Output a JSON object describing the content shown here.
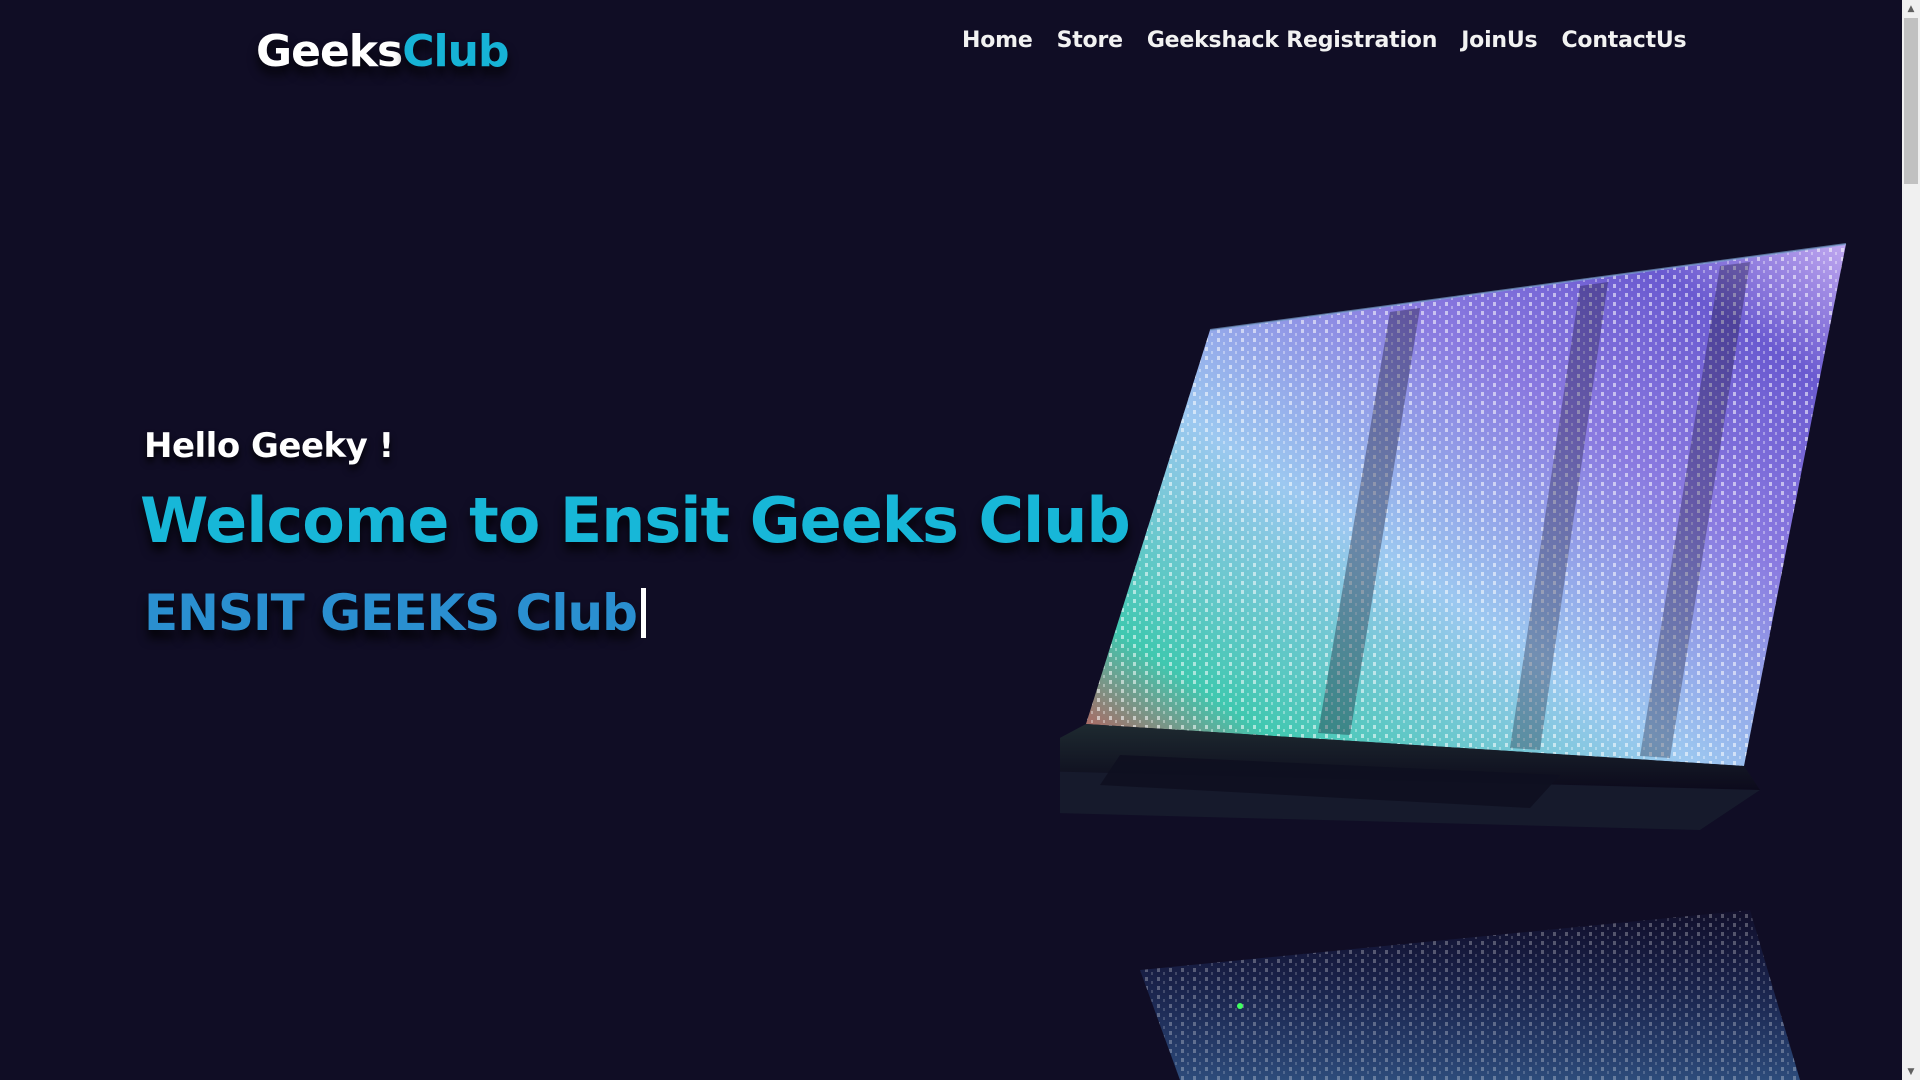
{
  "brand": {
    "part1": "Geeks",
    "part2": "Club",
    "color_primary": "#ffffff",
    "color_accent": "#16b3d6"
  },
  "nav": {
    "items": [
      {
        "label": "Home"
      },
      {
        "label": "Store"
      },
      {
        "label": "Geekshack Registration"
      },
      {
        "label": "JoinUs"
      },
      {
        "label": "ContactUs"
      }
    ]
  },
  "hero": {
    "greeting": "Hello Geeky !",
    "title": "Welcome to Ensit Geeks Club",
    "typed_text": "ENSIT GEEKS Club"
  },
  "theme": {
    "background": "#100d25",
    "title_color": "#17b7d8",
    "typed_color": "#2a8fd0"
  },
  "icons": {
    "scroll_up": "triangle-up-icon",
    "scroll_down": "triangle-down-icon"
  }
}
